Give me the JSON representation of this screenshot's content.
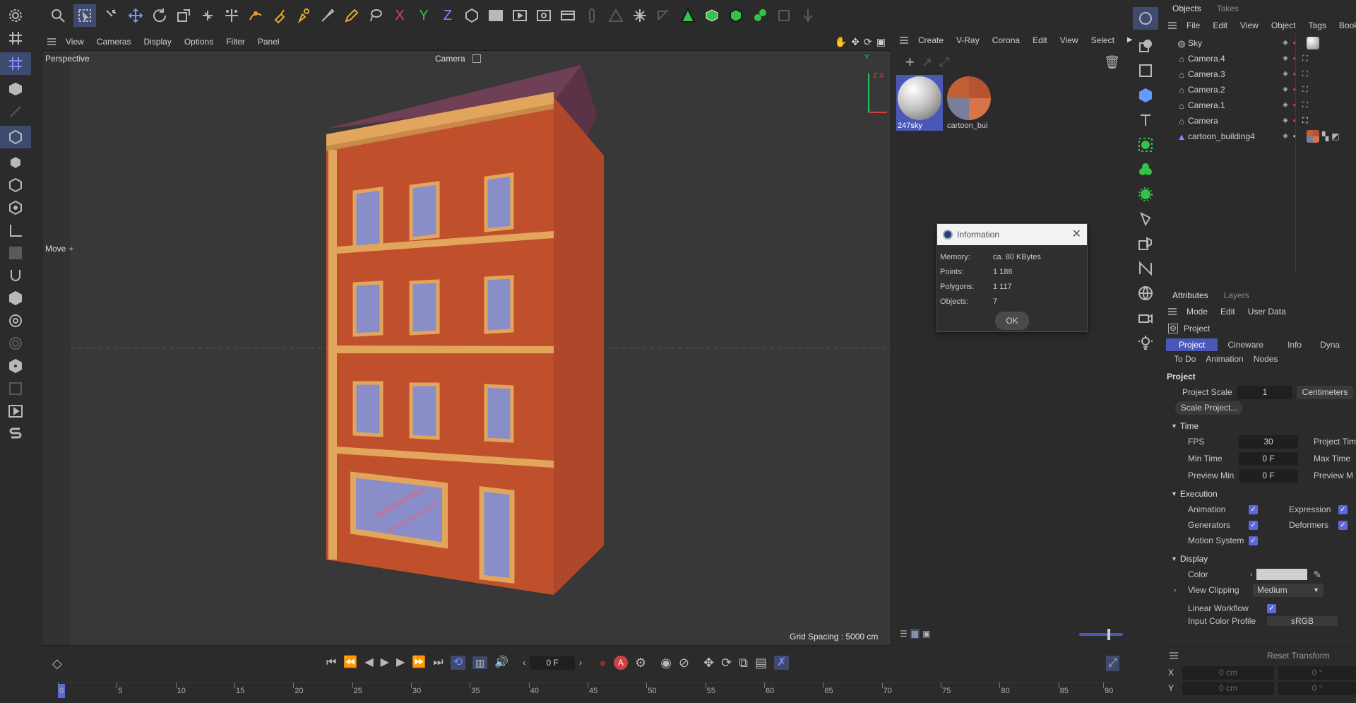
{
  "viewport": {
    "menu": [
      "View",
      "Cameras",
      "Display",
      "Options",
      "Filter",
      "Panel"
    ],
    "label": "Perspective",
    "camera": "Camera",
    "move_label": "Move",
    "grid_spacing": "Grid Spacing : 5000 cm",
    "axis_y": "Y",
    "axis_zx": "Z X"
  },
  "material_manager": {
    "menu": [
      "Create",
      "V-Ray",
      "Corona",
      "Edit",
      "View",
      "Select"
    ],
    "materials": [
      {
        "name": "247sky"
      },
      {
        "name": "cartoon_bui"
      }
    ]
  },
  "info_dialog": {
    "title": "Information",
    "rows": [
      {
        "label": "Memory:",
        "value": "ca. 80 KBytes"
      },
      {
        "label": "Points:",
        "value": "1 186"
      },
      {
        "label": "Polygons:",
        "value": "1 117"
      },
      {
        "label": "Objects:",
        "value": "7"
      }
    ],
    "ok_label": "OK"
  },
  "objects_panel": {
    "tabs": [
      "Objects",
      "Takes"
    ],
    "menu": [
      "File",
      "Edit",
      "View",
      "Object",
      "Tags",
      "Bookma"
    ],
    "items": [
      {
        "name": "Sky"
      },
      {
        "name": "Camera.4"
      },
      {
        "name": "Camera.3"
      },
      {
        "name": "Camera.2"
      },
      {
        "name": "Camera.1"
      },
      {
        "name": "Camera"
      },
      {
        "name": "cartoon_building4"
      }
    ]
  },
  "attributes": {
    "tabs": [
      "Attributes",
      "Layers"
    ],
    "menu": [
      "Mode",
      "Edit",
      "User Data"
    ],
    "header": "Project",
    "subtabs": [
      "Project",
      "Cineware",
      "Info",
      "Dyna"
    ],
    "subtabs2": [
      "To Do",
      "Animation",
      "Nodes"
    ],
    "section_project": "Project",
    "project_scale_label": "Project Scale",
    "project_scale_value": "1",
    "project_scale_unit": "Centimeters",
    "scale_project_button": "Scale Project...",
    "time_section": "Time",
    "fps_label": "FPS",
    "fps_value": "30",
    "project_time_label": "Project Tim",
    "min_time_label": "Min Time",
    "min_time_value": "0 F",
    "max_time_label": "Max Time",
    "preview_min_label": "Preview Min",
    "preview_min_value": "0 F",
    "preview_max_label": "Preview M",
    "execution_section": "Execution",
    "animation_label": "Animation",
    "expression_label": "Expression",
    "generators_label": "Generators",
    "deformers_label": "Deformers",
    "motion_system_label": "Motion System",
    "display_section": "Display",
    "color_label": "Color",
    "view_clipping_label": "View Clipping",
    "view_clipping_value": "Medium",
    "linear_workflow_label": "Linear Workflow",
    "input_color_profile_label": "Input Color Profile",
    "input_color_profile_value": "sRGB",
    "reset_transform_label": "Reset Transform",
    "coords": [
      {
        "label": "X",
        "value1": "0 cm",
        "value2": "0 °"
      },
      {
        "label": "Y",
        "value1": "0 cm",
        "value2": "0 °"
      }
    ]
  },
  "timeline": {
    "current_frame": "0 F",
    "ticks": [
      "0",
      "5",
      "10",
      "15",
      "20",
      "25",
      "30",
      "35",
      "40",
      "45",
      "50",
      "55",
      "60",
      "65",
      "70",
      "75",
      "80",
      "85",
      "90"
    ]
  },
  "colors": {
    "accent": "#5b6ad8",
    "background": "#2b2b2b",
    "viewport": "#383838",
    "brick": "#c0502c",
    "window_trim": "#e2a55c",
    "roof": "#5c3346",
    "sky_glass": "#8a8ec8"
  }
}
